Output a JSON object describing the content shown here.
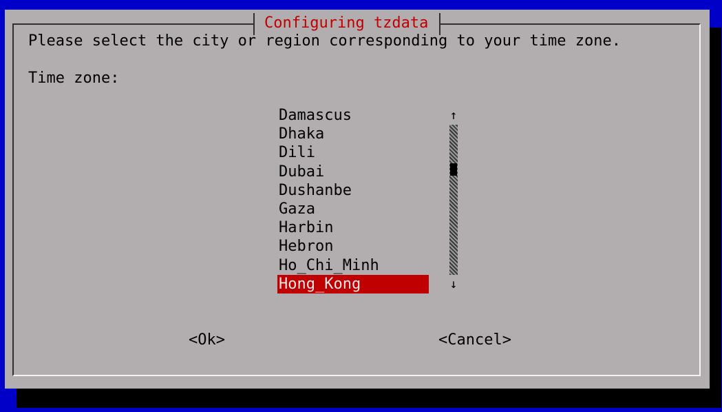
{
  "dialog": {
    "title": "Configuring tzdata",
    "prompt": "Please select the city or region corresponding to your time zone.",
    "label": "Time zone:"
  },
  "timezones": [
    "Damascus",
    "Dhaka",
    "Dili",
    "Dubai",
    "Dushanbe",
    "Gaza",
    "Harbin",
    "Hebron",
    "Ho_Chi_Minh",
    "Hong_Kong"
  ],
  "selected_timezone": "Hong_Kong",
  "scrollbar": {
    "up_arrow": "↑",
    "down_arrow": "↓",
    "thumb_position_fraction": 0.28
  },
  "buttons": {
    "ok": "<Ok>",
    "cancel": "<Cancel>"
  },
  "colors": {
    "background": "#0000c8",
    "dialog": "#b2aeb0",
    "accent": "#c00000",
    "shadow": "#000000"
  },
  "icons": {
    "scroll_up": "arrow-up-icon",
    "scroll_down": "arrow-down-icon"
  }
}
